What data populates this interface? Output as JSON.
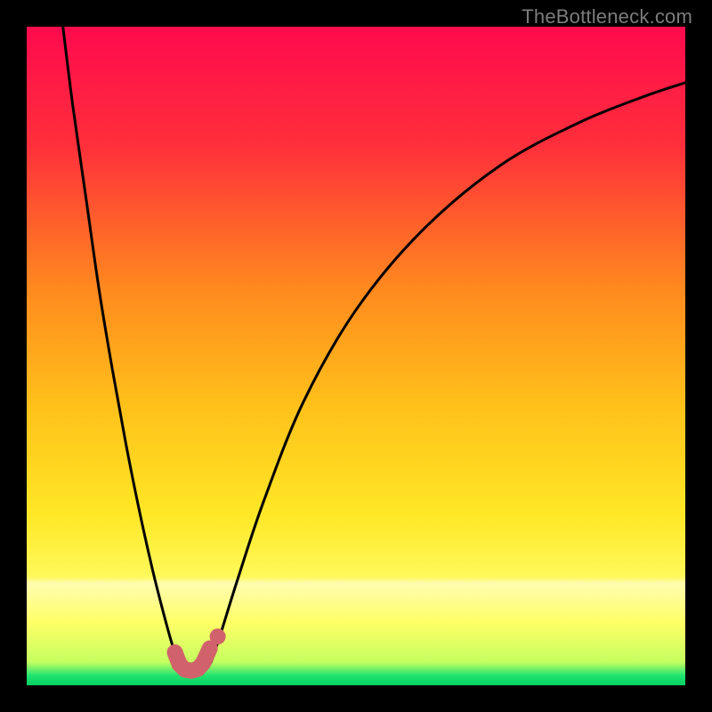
{
  "watermark": {
    "text": "TheBottleneck.com"
  },
  "colors": {
    "frame": "#000000",
    "gradient_stops": [
      {
        "pos": 0.0,
        "color": "#ff0a4e"
      },
      {
        "pos": 0.18,
        "color": "#ff2f3b"
      },
      {
        "pos": 0.4,
        "color": "#ff8a1e"
      },
      {
        "pos": 0.58,
        "color": "#ffc21a"
      },
      {
        "pos": 0.74,
        "color": "#ffe726"
      },
      {
        "pos": 0.835,
        "color": "#fff95a"
      },
      {
        "pos": 0.845,
        "color": "#fffcb0"
      },
      {
        "pos": 0.905,
        "color": "#ffff66"
      },
      {
        "pos": 0.965,
        "color": "#c4ff60"
      },
      {
        "pos": 0.985,
        "color": "#22e36f"
      },
      {
        "pos": 1.0,
        "color": "#05cf63"
      }
    ],
    "curve": "#000000",
    "marker": "#d1626b"
  },
  "chart_data": {
    "type": "line",
    "title": "",
    "xlabel": "",
    "ylabel": "",
    "xlim": [
      0,
      100
    ],
    "ylim": [
      0,
      100
    ],
    "grid": false,
    "series": [
      {
        "name": "left-branch",
        "x": [
          5.5,
          7,
          9,
          11,
          13,
          15,
          17,
          19,
          20.5,
          22,
          23.2
        ],
        "y": [
          100,
          88,
          74,
          60,
          48,
          37,
          27,
          18,
          12,
          6.5,
          2.8
        ]
      },
      {
        "name": "right-branch",
        "x": [
          28,
          29.5,
          32,
          36,
          42,
          50,
          60,
          72,
          84,
          94,
          100
        ],
        "y": [
          3.5,
          8,
          16,
          28,
          43,
          57,
          69,
          79,
          85.5,
          89.5,
          91.5
        ]
      },
      {
        "name": "valley-marker",
        "x": [
          22.5,
          23.2,
          24.0,
          25.0,
          26.0,
          26.8,
          27.8
        ],
        "y": [
          5.0,
          3.2,
          2.4,
          2.2,
          2.5,
          3.4,
          5.6
        ]
      }
    ],
    "minimum": {
      "x": 25.0,
      "y": 2.2
    }
  }
}
